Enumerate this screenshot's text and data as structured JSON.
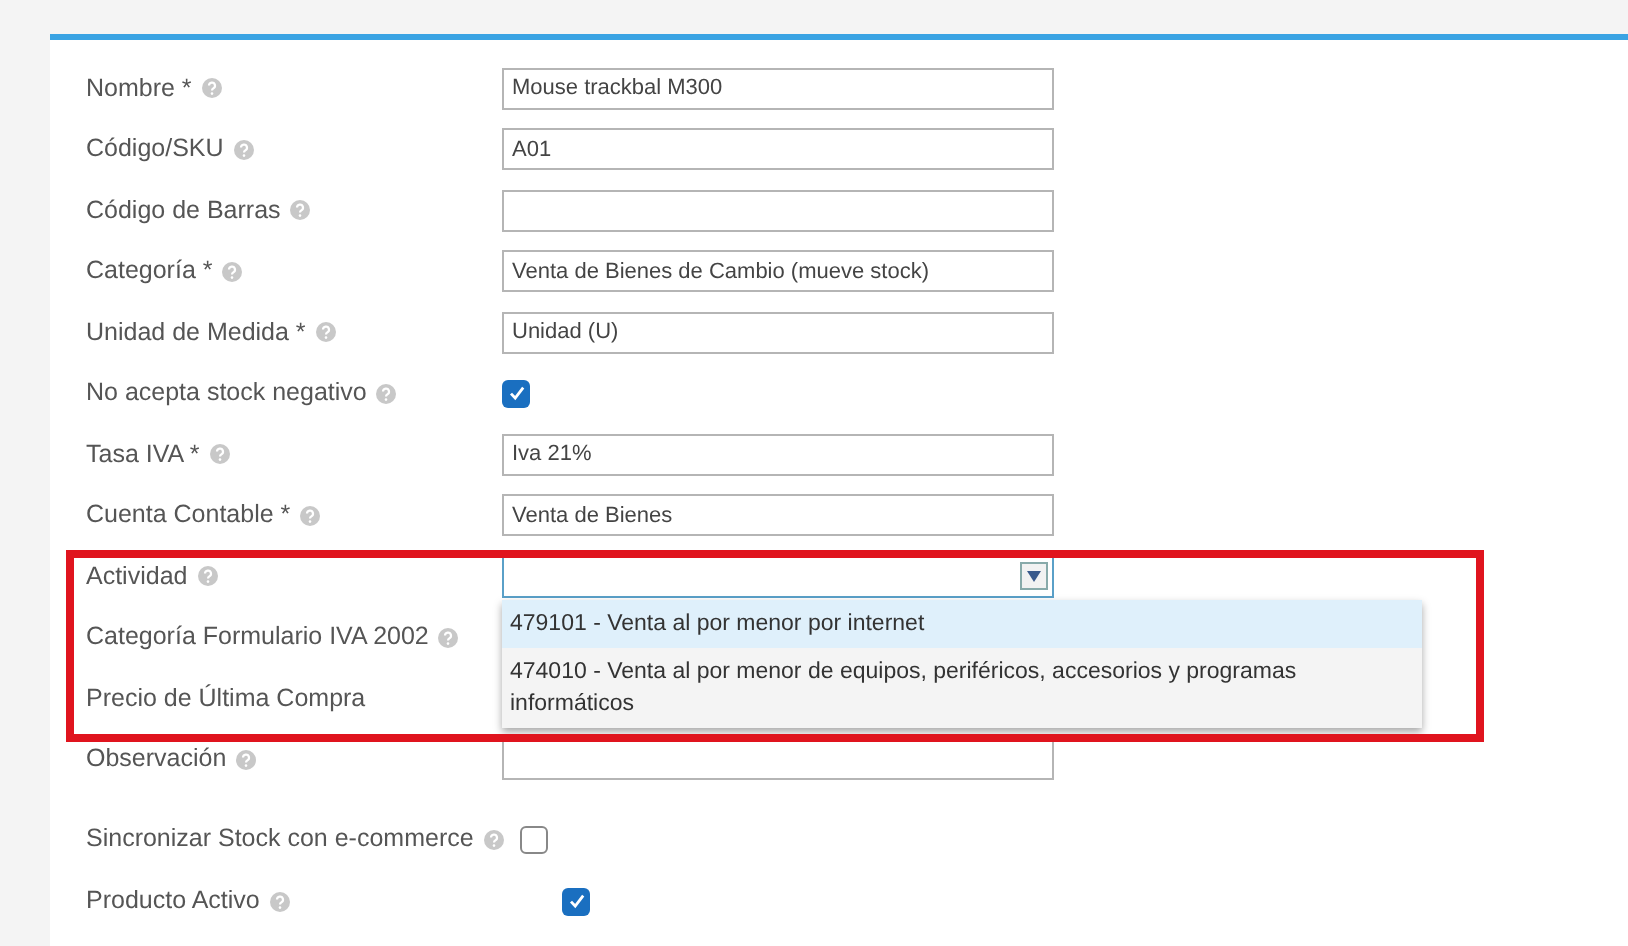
{
  "form": {
    "fields": [
      {
        "kind": "text",
        "label": "Nombre *",
        "help": true,
        "value": "Mouse trackbal M300"
      },
      {
        "kind": "text",
        "label": "Código/SKU",
        "help": true,
        "value": "A01"
      },
      {
        "kind": "text",
        "label": "Código de Barras",
        "help": true
      },
      {
        "kind": "text",
        "label": "Categoría *",
        "help": true,
        "value": "Venta de Bienes de Cambio (mueve stock)"
      },
      {
        "kind": "text",
        "label": "Unidad de Medida *",
        "help": true,
        "value": "Unidad (U)"
      },
      {
        "kind": "checkbox",
        "label": "No acepta stock negativo",
        "help": true,
        "checked": true
      },
      {
        "kind": "text",
        "label": "Tasa IVA *",
        "help": true,
        "value": "Iva 21%"
      },
      {
        "kind": "text",
        "label": "Cuenta Contable *",
        "help": true,
        "value": "Venta de Bienes"
      },
      {
        "kind": "select",
        "label": "Actividad",
        "help": true,
        "expanded": true,
        "options": [
          {
            "label": "479101 - Venta al por menor por internet",
            "selected": true
          },
          {
            "label": "474010 - Venta al por menor de equipos, periféricos, accesorios y programas informáticos",
            "selected": false
          }
        ]
      },
      {
        "kind": "covered",
        "label": "Categoría Formulario IVA 2002",
        "help": true
      },
      {
        "kind": "covered",
        "label": "Precio de Última Compra",
        "help": false
      },
      {
        "kind": "text",
        "label": "Observación",
        "help": true
      }
    ],
    "toggles": [
      {
        "label": "Sincronizar Stock con e-commerce",
        "help": true,
        "checked": false
      },
      {
        "label": "Producto Activo",
        "help": true,
        "checked": true
      }
    ]
  },
  "annotation_box": true
}
